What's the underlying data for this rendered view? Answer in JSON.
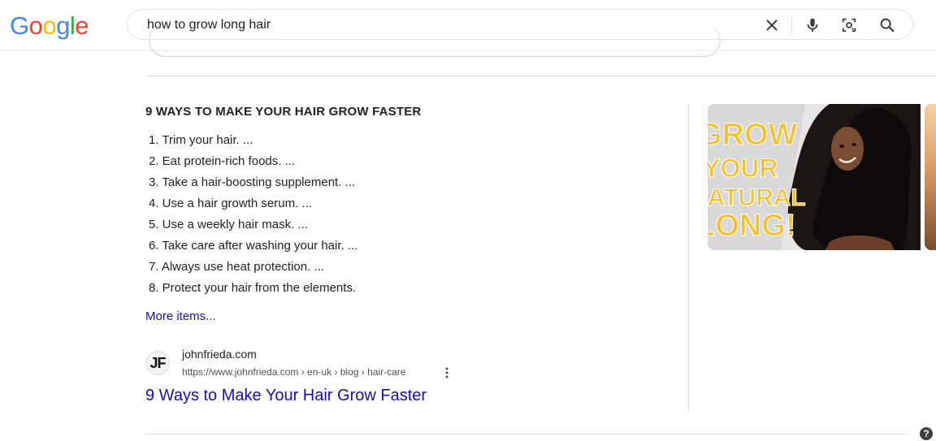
{
  "logo": {
    "letters": [
      "G",
      "o",
      "o",
      "g",
      "l",
      "e"
    ],
    "colors": [
      "#4285f4",
      "#ea4335",
      "#fbbc05",
      "#4285f4",
      "#34a853",
      "#ea4335"
    ]
  },
  "search": {
    "query": "how to grow long hair",
    "icons": [
      "close-icon",
      "microphone-icon",
      "lens-icon",
      "search-icon"
    ]
  },
  "snippet": {
    "title": "9 WAYS TO MAKE YOUR HAIR GROW FASTER",
    "items": [
      "1. Trim your hair. ...",
      "2. Eat protein-rich foods. ...",
      "3. Take a hair-boosting supplement. ...",
      "4. Use a hair growth serum. ...",
      "5. Use a weekly hair mask. ...",
      "6. Take care after washing your hair. ...",
      "7. Always use heat protection. ...",
      "8. Protect your hair from the elements."
    ],
    "more_label": "More items..."
  },
  "source": {
    "avatar_text": "JF",
    "site_name": "johnfrieda.com",
    "url": "https://www.johnfrieda.com › en-uk › blog › hair-care",
    "result_title": "9 Ways to Make Your Hair Grow Faster"
  },
  "thumbnail": {
    "lines": [
      "GROW",
      "YOUR",
      "NATURAL",
      "LONG!"
    ]
  },
  "help": {
    "label": "?"
  },
  "colors": {
    "link": "#1a0dab",
    "accent_yellow": "#f2c230"
  }
}
